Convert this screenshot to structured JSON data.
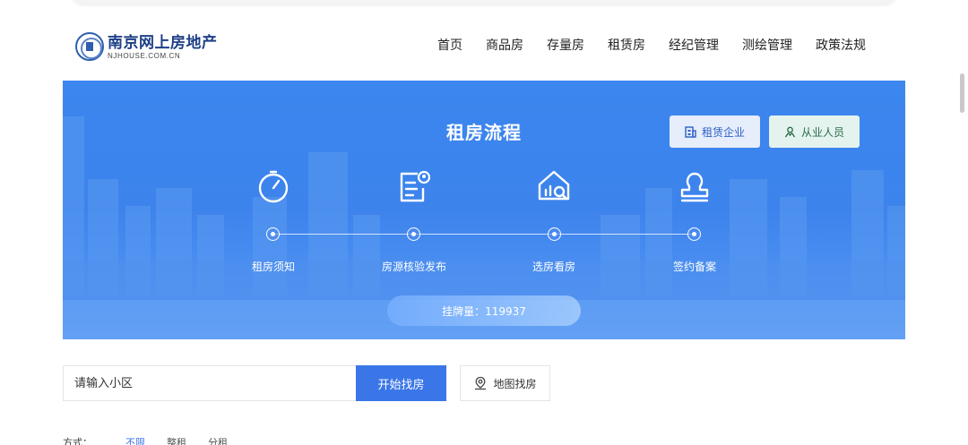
{
  "header": {
    "logo_cn": "南京网上房地产",
    "logo_en": "NJHOUSE.COM.CN",
    "nav": [
      "首页",
      "商品房",
      "存量房",
      "租赁房",
      "经纪管理",
      "测绘管理",
      "政策法规"
    ]
  },
  "banner": {
    "title": "租房流程",
    "company_button": "租赁企业",
    "staff_button": "从业人员",
    "steps": [
      {
        "label": "租房须知",
        "icon": "timer-icon"
      },
      {
        "label": "房源核验发布",
        "icon": "verify-document-icon"
      },
      {
        "label": "选房看房",
        "icon": "house-search-icon"
      },
      {
        "label": "签约备案",
        "icon": "stamp-icon"
      }
    ],
    "listing_count": "挂牌量：119937"
  },
  "search": {
    "placeholder": "请输入小区",
    "start_button": "开始找房",
    "map_button": "地图找房"
  },
  "filter": {
    "label": "方式：",
    "options": [
      "不限",
      "整租",
      "分租"
    ],
    "active": "不限"
  },
  "colors": {
    "banner_blue": "#3d83ec",
    "primary_button": "#3a76e8",
    "logo_navy": "#1d3f87"
  }
}
